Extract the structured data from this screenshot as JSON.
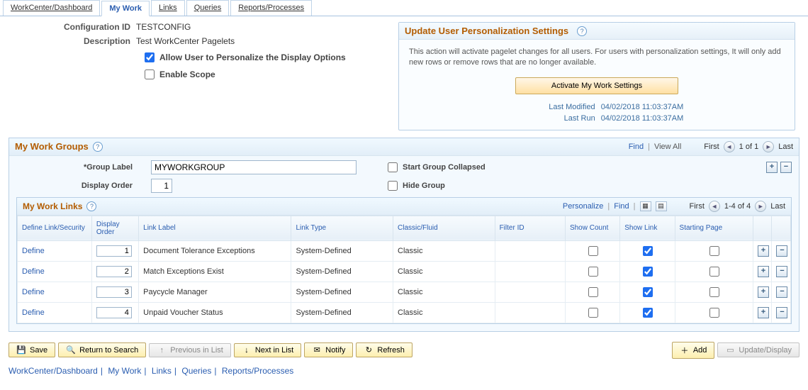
{
  "tabs": [
    "WorkCenter/Dashboard",
    "My Work",
    "Links",
    "Queries",
    "Reports/Processes"
  ],
  "active_tab": 1,
  "config": {
    "id_label": "Configuration ID",
    "id_value": "TESTCONFIG",
    "desc_label": "Description",
    "desc_value": "Test WorkCenter Pagelets",
    "allow_personalize_label": "Allow User to Personalize the Display Options",
    "allow_personalize_checked": true,
    "enable_scope_label": "Enable Scope",
    "enable_scope_checked": false
  },
  "settings": {
    "title": "Update User Personalization Settings",
    "note": "This action will activate pagelet changes for all users.  For users with personalization settings, It will only add new rows or remove rows that are no longer available.",
    "button": "Activate My Work Settings",
    "last_modified_label": "Last Modified",
    "last_modified_value": "04/02/2018 11:03:37AM",
    "last_run_label": "Last Run",
    "last_run_value": "04/02/2018 11:03:37AM"
  },
  "groups": {
    "title": "My Work Groups",
    "find": "Find",
    "view_all": "View All",
    "first": "First",
    "range": "1 of 1",
    "last": "Last",
    "group_label_text": "*Group Label",
    "group_label_value": "MYWORKGROUP",
    "display_order_label": "Display Order",
    "display_order_value": "1",
    "start_collapsed_label": "Start Group Collapsed",
    "start_collapsed_checked": false,
    "hide_group_label": "Hide Group",
    "hide_group_checked": false
  },
  "links": {
    "title": "My Work Links",
    "personalize": "Personalize",
    "find": "Find",
    "first": "First",
    "range": "1-4 of 4",
    "last": "Last",
    "headers": [
      "Define Link/Security",
      "Display Order",
      "Link Label",
      "Link Type",
      "Classic/Fluid",
      "Filter ID",
      "Show Count",
      "Show Link",
      "Starting Page",
      "",
      ""
    ],
    "rows": [
      {
        "define": "Define",
        "order": "1",
        "label": "Document Tolerance Exceptions",
        "type": "System-Defined",
        "cf": "Classic",
        "filter": "",
        "show_count": false,
        "show_link": true,
        "starting": false
      },
      {
        "define": "Define",
        "order": "2",
        "label": "Match Exceptions Exist",
        "type": "System-Defined",
        "cf": "Classic",
        "filter": "",
        "show_count": false,
        "show_link": true,
        "starting": false
      },
      {
        "define": "Define",
        "order": "3",
        "label": "Paycycle Manager",
        "type": "System-Defined",
        "cf": "Classic",
        "filter": "",
        "show_count": false,
        "show_link": true,
        "starting": false
      },
      {
        "define": "Define",
        "order": "4",
        "label": "Unpaid Voucher Status",
        "type": "System-Defined",
        "cf": "Classic",
        "filter": "",
        "show_count": false,
        "show_link": true,
        "starting": false
      }
    ]
  },
  "toolbar": {
    "save": "Save",
    "return": "Return to Search",
    "prev": "Previous in List",
    "next": "Next in List",
    "notify": "Notify",
    "refresh": "Refresh",
    "add": "Add",
    "update": "Update/Display"
  },
  "bottom_nav": [
    "WorkCenter/Dashboard",
    "My Work",
    "Links",
    "Queries",
    "Reports/Processes"
  ]
}
